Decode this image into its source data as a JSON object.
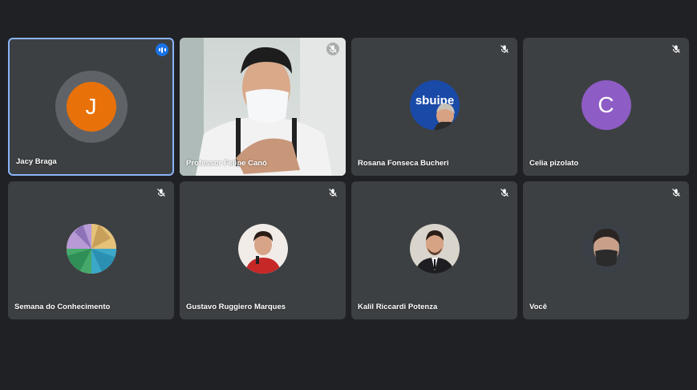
{
  "participants": [
    {
      "name": "Jacy Braga",
      "avatar_letter": "J",
      "avatar_color": "#e8710a",
      "speaking": true,
      "muted": false
    },
    {
      "name": "Professor Felipe Canó",
      "video": true,
      "muted": true
    },
    {
      "name": "Rosana Fonseca Bucheri",
      "avatar_text": "sbuipe",
      "muted": true
    },
    {
      "name": "Celia pizolato",
      "avatar_letter": "C",
      "avatar_color": "#8e5cc5",
      "muted": true
    },
    {
      "name": "Semana do Conhecimento",
      "muted": true
    },
    {
      "name": "Gustavo Ruggiero Marques",
      "muted": true
    },
    {
      "name": "Kalil Riccardi Potenza",
      "muted": true
    },
    {
      "name": "Você",
      "muted": true
    }
  ],
  "colors": {
    "background": "#202124",
    "tile": "#3c4043",
    "active_border": "#8ab4f8",
    "speaking": "#1a73e8"
  }
}
